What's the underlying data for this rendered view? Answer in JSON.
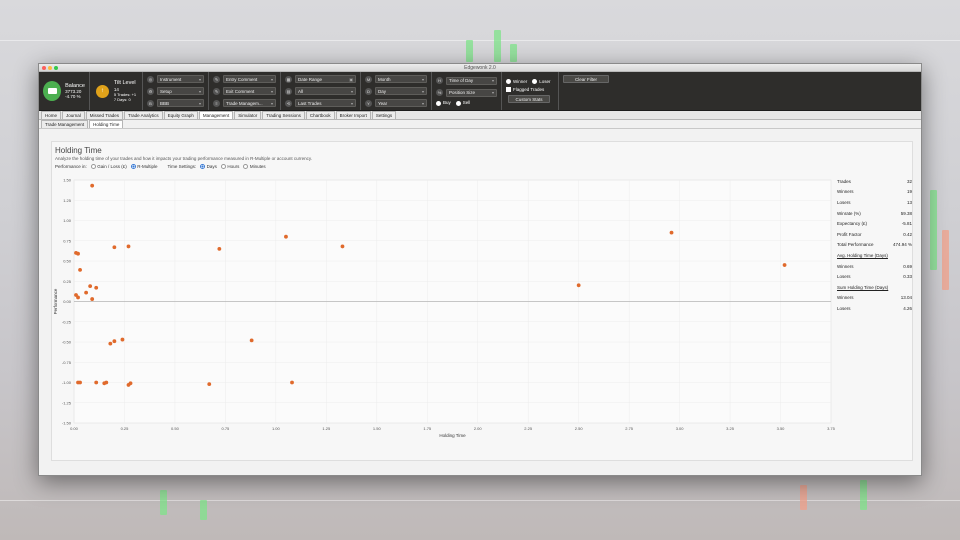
{
  "window": {
    "title": "Edgewonk 2.0"
  },
  "toolbar": {
    "balance": {
      "label": "Balance",
      "value": "3773.20",
      "change": "-4.70 %"
    },
    "tilt": {
      "label": "Tilt Level",
      "value": "14",
      "trades": "5 Trades: +1",
      "days": "7 Days: 0"
    },
    "filters1": [
      {
        "icon": "instrument-icon",
        "label": "Instrument"
      },
      {
        "icon": "setup-icon",
        "label": "Setup"
      },
      {
        "icon": "tag-icon",
        "label": "BBB"
      }
    ],
    "filters2": [
      {
        "icon": "entry-comment-icon",
        "label": "Entry Comment"
      },
      {
        "icon": "exit-comment-icon",
        "label": "Exit Comment"
      },
      {
        "icon": "trade-management-icon",
        "label": "Trade Managem..."
      }
    ],
    "filters3": [
      {
        "icon": "calendar-icon",
        "label": "Date Range"
      },
      {
        "icon": "filter-all-icon",
        "label": "All"
      },
      {
        "icon": "last-trades-icon",
        "label": "Last Trades"
      }
    ],
    "filters4": [
      {
        "icon": "M",
        "label": "Month"
      },
      {
        "icon": "D",
        "label": "Day"
      },
      {
        "icon": "Y",
        "label": "Year"
      }
    ],
    "filters5": [
      {
        "icon": "H",
        "label": "Time of Day"
      },
      {
        "icon": "size-icon",
        "label": "Position Size"
      }
    ],
    "buy": "Buy",
    "sell": "Sell",
    "winner": "Winner",
    "loser": "Loser",
    "flagged": "Flagged Trades",
    "custom_stats": "Custom Stats",
    "clear_filter": "Clear Filter"
  },
  "tabs": [
    "Home",
    "Journal",
    "Missed Trades",
    "Trade Analytics",
    "Equity Graph",
    "Management",
    "Simulator",
    "Trading Sessions",
    "Chartbook",
    "Broker Import",
    "Settings"
  ],
  "active_tab": "Management",
  "subtabs": [
    "Trade Management",
    "Holding Time"
  ],
  "active_subtab": "Holding Time",
  "main": {
    "title": "Holding Time",
    "description": "Analyze the holding time of your trades and how it impacts your trading performance measured in R-Multiple or account currency.",
    "performance_label": "Performance in:",
    "performance_options": [
      "Gain / Loss (£)",
      "R-Multiple"
    ],
    "performance_selected": "R-Multiple",
    "time_label": "Time Settings:",
    "time_options": [
      "Days",
      "Hours",
      "Minutes"
    ],
    "time_selected": "Days"
  },
  "stats": {
    "rows": [
      {
        "label": "Trades",
        "value": "32"
      },
      {
        "label": "Winners",
        "value": "19"
      },
      {
        "label": "Losers",
        "value": "13"
      },
      {
        "label": "Winrate (%)",
        "value": "59.38"
      },
      {
        "label": "Expectancy (£)",
        "value": "-5.81"
      },
      {
        "label": "Profit Factor",
        "value": "0.42"
      },
      {
        "label": "Total Performance",
        "value": "474.94 %"
      }
    ],
    "avg_head": "Avg. Holding Time (Days)",
    "avg_rows": [
      {
        "label": "Winners",
        "value": "0.69"
      },
      {
        "label": "Losers",
        "value": "0.33"
      }
    ],
    "sum_head": "Sum Holding Time (Days)",
    "sum_rows": [
      {
        "label": "Winners",
        "value": "13.04"
      },
      {
        "label": "Losers",
        "value": "4.26"
      }
    ]
  },
  "chart_data": {
    "type": "scatter",
    "xlabel": "Holding Time",
    "ylabel": "Performance",
    "xlim": [
      0,
      3.75
    ],
    "ylim": [
      -1.5,
      1.5
    ],
    "x_ticks": [
      "0.00",
      "0.25",
      "0.50",
      "0.75",
      "1.00",
      "1.25",
      "1.50",
      "1.75",
      "2.00",
      "2.25",
      "2.50",
      "2.75",
      "3.00",
      "3.25",
      "3.50",
      "3.75"
    ],
    "y_ticks": [
      "1.50",
      "1.25",
      "1.00",
      "0.75",
      "0.50",
      "0.25",
      "0.00",
      "-0.25",
      "-0.50",
      "-0.75",
      "-1.00",
      "-1.25",
      "-1.50"
    ],
    "grid": true,
    "color": "#e06a2c",
    "points": [
      {
        "x": 0.09,
        "y": 1.43
      },
      {
        "x": 0.01,
        "y": 0.6
      },
      {
        "x": 0.02,
        "y": 0.59
      },
      {
        "x": 0.03,
        "y": 0.39
      },
      {
        "x": 0.2,
        "y": 0.67
      },
      {
        "x": 0.27,
        "y": 0.68
      },
      {
        "x": 0.72,
        "y": 0.65
      },
      {
        "x": 1.05,
        "y": 0.8
      },
      {
        "x": 1.33,
        "y": 0.68
      },
      {
        "x": 2.5,
        "y": 0.2
      },
      {
        "x": 2.96,
        "y": 0.85
      },
      {
        "x": 3.52,
        "y": 0.45
      },
      {
        "x": 0.01,
        "y": 0.08
      },
      {
        "x": 0.02,
        "y": 0.05
      },
      {
        "x": 0.06,
        "y": 0.11
      },
      {
        "x": 0.08,
        "y": 0.19
      },
      {
        "x": 0.11,
        "y": 0.17
      },
      {
        "x": 0.09,
        "y": 0.03
      },
      {
        "x": 0.18,
        "y": -0.52
      },
      {
        "x": 0.2,
        "y": -0.49
      },
      {
        "x": 0.24,
        "y": -0.47
      },
      {
        "x": 0.88,
        "y": -0.48
      },
      {
        "x": 0.02,
        "y": -1.0
      },
      {
        "x": 0.03,
        "y": -1.0
      },
      {
        "x": 0.11,
        "y": -1.0
      },
      {
        "x": 0.15,
        "y": -1.01
      },
      {
        "x": 0.16,
        "y": -1.0
      },
      {
        "x": 0.27,
        "y": -1.03
      },
      {
        "x": 0.28,
        "y": -1.01
      },
      {
        "x": 0.67,
        "y": -1.02
      },
      {
        "x": 1.08,
        "y": -1.0
      }
    ]
  }
}
